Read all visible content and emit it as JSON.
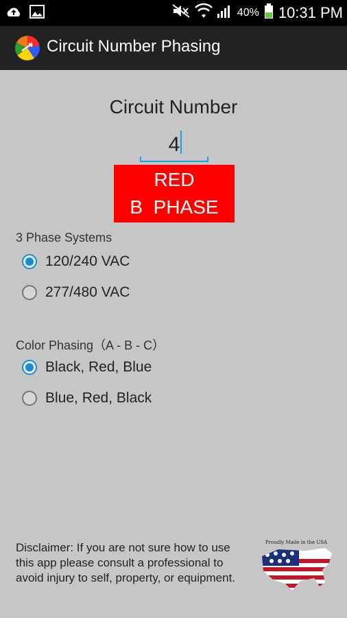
{
  "status_bar": {
    "battery_percent": "40%",
    "time": "10:31 PM"
  },
  "app_bar": {
    "title": "Circuit Number Phasing"
  },
  "circuit": {
    "label": "Circuit Number",
    "value": "4"
  },
  "phase_result": {
    "color_name": "RED",
    "phase_name": "B  PHASE",
    "color": "#ff0000"
  },
  "phase_systems": {
    "title": "3 Phase Systems",
    "options": [
      "120/240 VAC",
      "277/480 VAC"
    ],
    "selected_index": 0
  },
  "color_phasing": {
    "title": "Color Phasing（A - B - C）",
    "options": [
      "Black, Red, Blue",
      "Blue, Red, Black"
    ],
    "selected_index": 0
  },
  "disclaimer": {
    "text": "Disclaimer: If you are not sure how to use this app please consult a professional to avoid injury to self, property, or equipment."
  },
  "badge": {
    "caption": "Proudly Made in the USA"
  },
  "colors": {
    "accent": "#1a8ccf",
    "background": "#c6c6c6",
    "app_bar": "#222222"
  }
}
